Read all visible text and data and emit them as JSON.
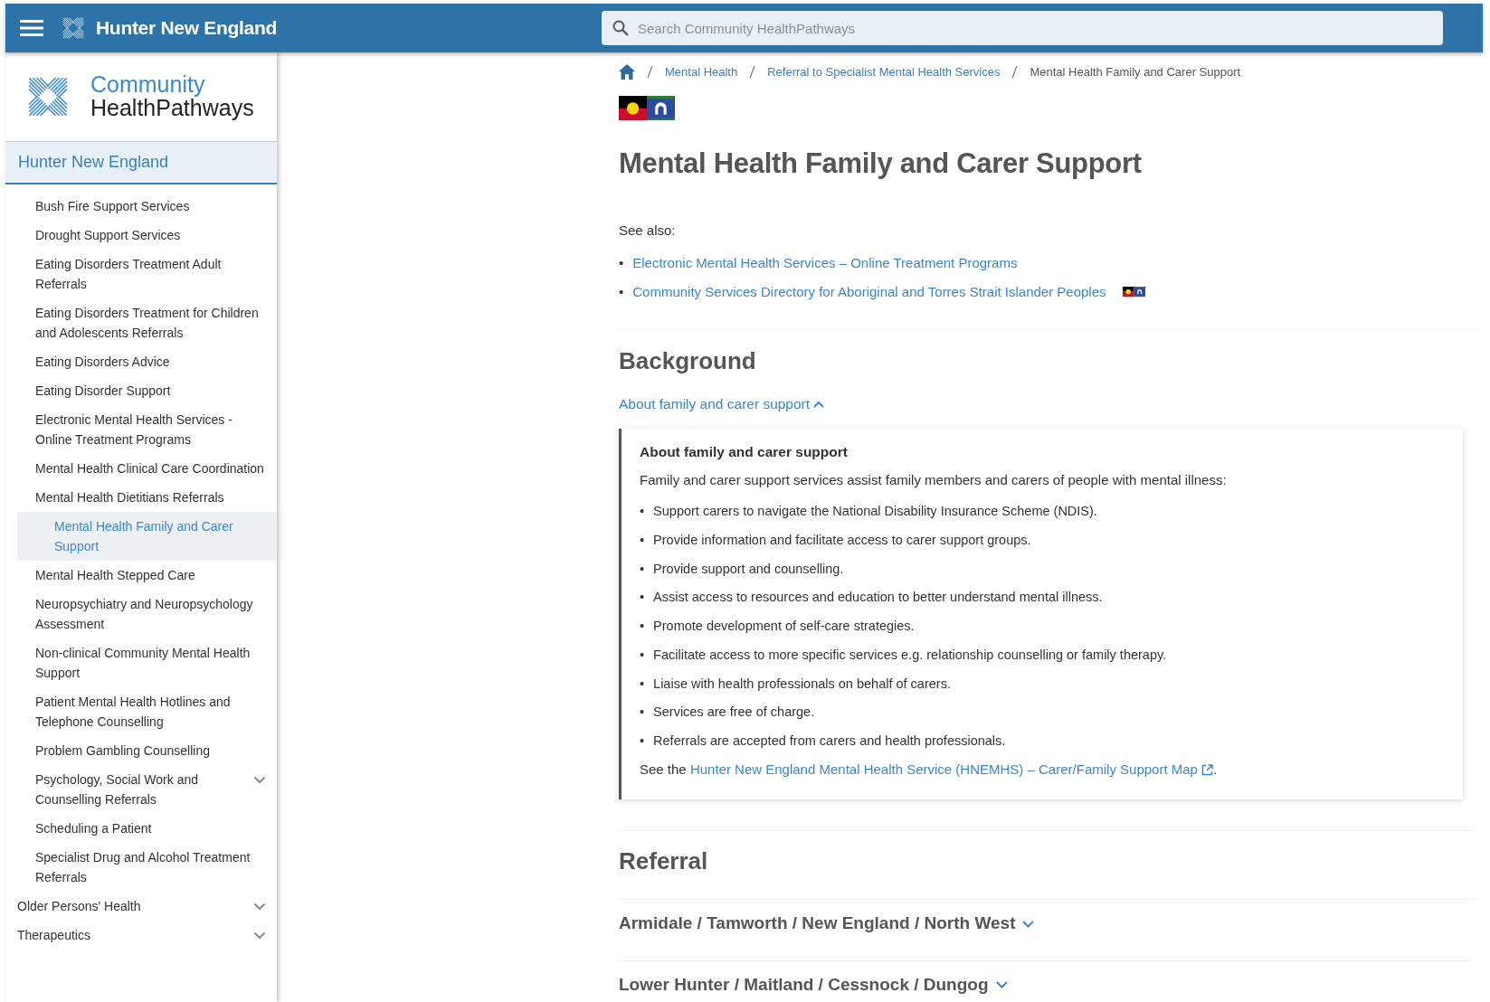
{
  "top_bar": {
    "title": "Hunter New England",
    "search": {
      "placeholder": "Search Community HealthPathways"
    }
  },
  "sidebar": {
    "logo": {
      "line_1": "Community",
      "line_2": "HealthPathways"
    },
    "header": "Hunter New England",
    "items": [
      {
        "children": [
          {
            "label": "Bush Fire Support Services",
            "selected": false,
            "collapsed": false
          },
          {
            "label": "Drought Support Services",
            "selected": false,
            "collapsed": false
          },
          {
            "label": "Eating Disorders Treatment Adult Referrals",
            "selected": false,
            "collapsed": false
          },
          {
            "label": "Eating Disorders Treatment for Children and Adolescents Referrals",
            "selected": false,
            "collapsed": false
          },
          {
            "label": "Eating Disorders Advice",
            "selected": false,
            "collapsed": false
          },
          {
            "label": "Eating Disorder Support",
            "selected": false,
            "collapsed": false
          },
          {
            "label": "Electronic Mental Health Services - Online Treatment Programs",
            "selected": false,
            "collapsed": false
          },
          {
            "label": "Mental Health Clinical Care Coordination",
            "selected": false,
            "collapsed": false
          },
          {
            "label": "Mental Health Dietitians Referrals",
            "selected": false,
            "collapsed": false
          },
          {
            "label": "Mental Health Family and Carer Support",
            "selected": true,
            "collapsed": false
          },
          {
            "label": "Mental Health Stepped Care",
            "selected": false,
            "collapsed": false
          },
          {
            "label": "Neuropsychiatry and Neuropsychology Assessment",
            "selected": false,
            "collapsed": false
          },
          {
            "label": "Non-clinical Community Mental Health Support",
            "selected": false,
            "collapsed": false
          },
          {
            "label": "Patient Mental Health Hotlines and Telephone Counselling",
            "selected": false,
            "collapsed": false
          },
          {
            "label": "Problem Gambling Counselling",
            "selected": false,
            "collapsed": false
          },
          {
            "label": "Psychology, Social Work and Counselling Referrals",
            "selected": false,
            "collapsed": true
          },
          {
            "label": "Scheduling a Patient",
            "selected": false,
            "collapsed": false
          },
          {
            "label": "Specialist Drug and Alcohol Treatment Referrals",
            "selected": false,
            "collapsed": false
          }
        ]
      },
      {
        "label": "Older Persons' Health",
        "selected": false,
        "collapsed": true
      },
      {
        "label": "Therapeutics",
        "selected": false,
        "collapsed": true
      }
    ]
  },
  "breadcrumb": [
    {
      "label": "Mental Health",
      "link": true
    },
    {
      "label": "Referral to Specialist Mental Health Services",
      "link": true
    },
    {
      "label": "Mental Health Family and Carer Support",
      "link": false
    }
  ],
  "page_title": "Mental Health Family and Carer Support",
  "see_also": {
    "label": "See also:",
    "marker": "•",
    "links": [
      {
        "text": "Electronic Mental Health Services – Online Treatment Programs"
      },
      {
        "text": "Community Services Directory for Aboriginal and Torres Strait Islander Peoples",
        "flags": true
      }
    ]
  },
  "background": {
    "heading": "Background",
    "toggle": {
      "label": "About family and carer support",
      "expanded": true
    },
    "panel": {
      "marker": "•",
      "title": "About family and carer support",
      "intro": "Family and carer support services assist family members and carers of people with mental illness:",
      "bullets": [
        "Support carers to navigate the National Disability Insurance Scheme (NDIS).",
        "Provide information and facilitate access to carer support groups.",
        "Provide support and counselling.",
        "Assist access to resources and education to better understand mental illness.",
        "Promote development of self-care strategies.",
        "Facilitate access to more specific services e.g. relationship counselling or family therapy.",
        "Liaise with health professionals on behalf of carers.",
        "Services are free of charge.",
        "Referrals are accepted from carers and health professionals."
      ],
      "footer": {
        "before": "See the ",
        "link": "Hunter New England Mental Health Service (HNEMHS) – Carer/Family Support Map",
        "after": "."
      }
    }
  },
  "referral": {
    "heading": "Referral",
    "regions": [
      {
        "label": "Armidale / Tamworth / New England / North West",
        "expanded": false
      },
      {
        "label": "Lower Hunter / Maitland / Cessnock / Dungog",
        "expanded": false
      }
    ]
  }
}
